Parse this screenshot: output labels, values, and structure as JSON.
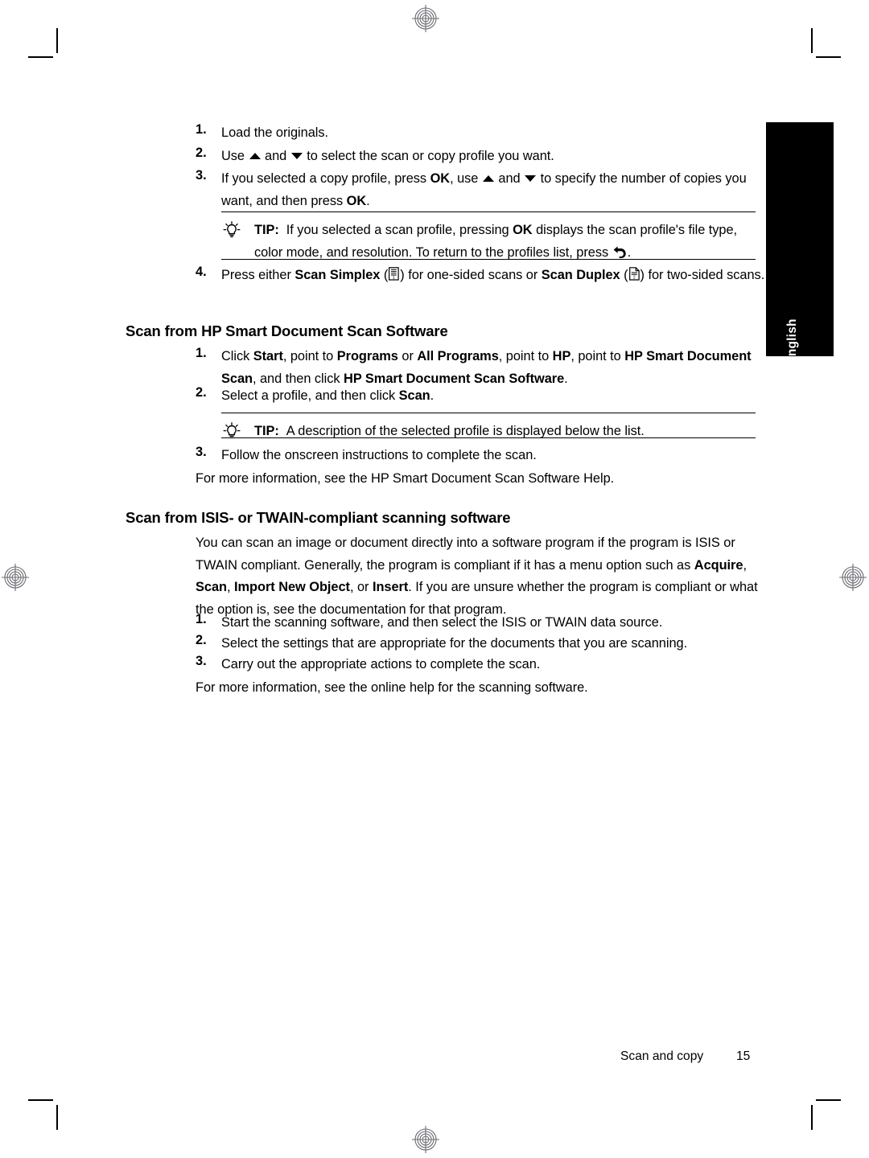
{
  "document": {
    "language_tab": "English",
    "footer": {
      "section_title": "Scan and copy",
      "page_number": "15"
    }
  },
  "steps_top": [
    {
      "num": "1.",
      "text_html": "Load the originals."
    },
    {
      "num": "2.",
      "text_html": "Use <span class=\"glyph-arrow-up\" data-name=\"arrow-up-icon\" data-interactable=\"false\"></span> and <span class=\"glyph-arrow-down\" data-name=\"arrow-down-icon\" data-interactable=\"false\"></span> to select the scan or copy profile you want."
    },
    {
      "num": "3.",
      "text_html": "If you selected a copy profile, press <b>OK</b>, use <span class=\"glyph-arrow-up\" data-name=\"arrow-up-icon\" data-interactable=\"false\"></span> and <span class=\"glyph-arrow-down\" data-name=\"arrow-down-icon\" data-interactable=\"false\"></span> to specify the number of copies you want, and then press <b>OK</b>."
    }
  ],
  "tip_1": {
    "label": "TIP:",
    "text_html": "If you selected a scan profile, pressing <b>OK</b> displays the scan profile's file type, color mode, and resolution. To return to the profiles list, press <span class=\"glyph-back\" data-name=\"back-arrow-icon\" data-interactable=\"false\"><svg width=\"17\" height=\"15\" viewBox=\"0 0 17 15\"><path d=\"M5.6 3.0 L5.6 0.4 L0.6 4.6 L5.6 8.8 L5.6 6.2 L9.3 6.2 C11.6 6.2 12.9 7.6 12.9 9.6 C12.9 11.6 11.6 13.0 9.3 13.0 L7.6 13.0 L7.6 15.0 L9.6 15.0 C13.3 15.0 15.7 12.7 15.7 9.5 C15.7 6.0 13.3 3.0 9.4 3.0 Z\" fill=\"#000\"/></svg></span>."
  },
  "step_4": {
    "num": "4.",
    "text_html": "Press either <b>Scan Simplex</b> (<span class=\"glyph-inline-svg\" data-name=\"scan-simplex-icon\" data-interactable=\"false\"><svg width=\"15\" height=\"17\" viewBox=\"0 0 15 17\"><rect x=\"1.6\" y=\"0.8\" width=\"11.5\" height=\"15.2\" fill=\"none\" stroke=\"#000\" stroke-width=\"1.2\"/><line x1=\"4\" y1=\"3.4\" x2=\"10.7\" y2=\"3.4\" stroke=\"#000\" stroke-width=\"1\"/><line x1=\"4\" y1=\"5.6\" x2=\"10.7\" y2=\"5.6\" stroke=\"#000\" stroke-width=\"1\"/><line x1=\"4\" y1=\"7.8\" x2=\"10.7\" y2=\"7.8\" stroke=\"#000\" stroke-width=\"1\"/><line x1=\"4\" y1=\"10.0\" x2=\"10.7\" y2=\"10.0\" stroke=\"#000\" stroke-width=\"1\"/><text x=\"7.3\" y=\"14.8\" font-size=\"5\" text-anchor=\"middle\" font-family=\"Liberation Sans, sans-serif\" fill=\"#000\">1</text></svg></span>) for one-sided scans or <b>Scan Duplex</b> (<span class=\"glyph-inline-svg\" data-name=\"scan-duplex-icon\" data-interactable=\"false\"><svg width=\"15\" height=\"17\" viewBox=\"0 0 15 17\"><path d=\"M1.7 0.8 L9.3 0.8 L13.1 4.6 L13.1 16.0 L1.7 16.0 Z\" fill=\"none\" stroke=\"#000\" stroke-width=\"1.2\"/><path d=\"M9.3 0.8 L9.3 4.6 L13.1 4.6\" fill=\"none\" stroke=\"#000\" stroke-width=\"1.2\"/><line x1=\"3.8\" y1=\"7.0\" x2=\"10.9\" y2=\"7.0\" stroke=\"#000\" stroke-width=\"1\"/><line x1=\"3.8\" y1=\"9.2\" x2=\"10.9\" y2=\"9.2\" stroke=\"#000\" stroke-width=\"1\"/><text x=\"7.3\" y=\"14.6\" font-size=\"5\" text-anchor=\"middle\" font-family=\"Liberation Sans, sans-serif\" fill=\"#000\">2</text></svg></span>) for two-sided scans."
  },
  "section_hp_smart": {
    "heading": "Scan from HP Smart Document Scan Software",
    "steps": [
      {
        "num": "1.",
        "text_html": "Click <b>Start</b>, point to <b>Programs</b> or <b>All Programs</b>, point to <b>HP</b>, point to <b>HP Smart Document Scan</b>, and then click <b>HP Smart Document Scan Software</b>."
      },
      {
        "num": "2.",
        "text_html": "Select a profile, and then click <b>Scan</b>."
      }
    ],
    "tip": {
      "label": "TIP:",
      "text_html": "A description of the selected profile is displayed below the list."
    },
    "step_3": {
      "num": "3.",
      "text_html": "Follow the onscreen instructions to complete the scan."
    },
    "closing": "For more information, see the HP Smart Document Scan Software Help."
  },
  "section_isis_twain": {
    "heading": "Scan from ISIS- or TWAIN-compliant scanning software",
    "intro_html": "You can scan an image or document directly into a software program if the program is ISIS or TWAIN compliant. Generally, the program is compliant if it has a menu option such as <b>Acquire</b>, <b>Scan</b>, <b>Import New Object</b>, or <b>Insert</b>. If you are unsure whether the program is compliant or what the option is, see the documentation for that program.",
    "steps": [
      {
        "num": "1.",
        "text_html": "Start the scanning software, and then select the ISIS or TWAIN data source."
      },
      {
        "num": "2.",
        "text_html": "Select the settings that are appropriate for the documents that you are scanning."
      },
      {
        "num": "3.",
        "text_html": "Carry out the appropriate actions to complete the scan."
      }
    ],
    "closing": "For more information, see the online help for the scanning software."
  },
  "colors": {
    "text": "#000000",
    "page_background": "#ffffff",
    "tab_background": "#000000",
    "tab_text": "#ffffff",
    "registration_mark": "#6a6a72"
  }
}
